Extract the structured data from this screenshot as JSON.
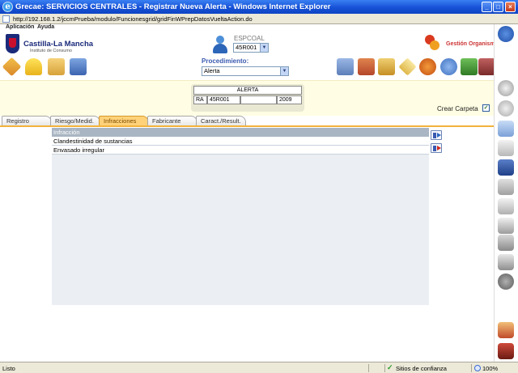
{
  "window": {
    "title": "Grecae: SERVICIOS CENTRALES - Registrar Nueva Alerta - Windows Internet Explorer",
    "url": "http://192.168.1.2/jccmPrueba/modulo/Funcionesgrid/gridFinWPrepDatosVueltaAction.do"
  },
  "menu": {
    "items": [
      "Aplicación",
      "Ayuda"
    ]
  },
  "header": {
    "logo_title": "Castilla-La Mancha",
    "logo_subtitle": "Instituto de Consumo",
    "user_name": "ESPCOAL",
    "user_code": "45R001",
    "procedimiento_label": "Procedimiento:",
    "procedimiento_value": "Alerta",
    "gestion_label": "Gestión Organismo"
  },
  "alerta": {
    "title": "ALERTA",
    "cells": [
      "RA",
      "45R001",
      "",
      "2009"
    ]
  },
  "crear_carpeta": {
    "label": "Crear Carpeta",
    "checked": true,
    "check_glyph": "✓"
  },
  "tabs": [
    {
      "label": "Registro",
      "active": false
    },
    {
      "label": "Riesgo/Medid.",
      "active": false
    },
    {
      "label": "Infracciones",
      "active": true
    },
    {
      "label": "Fabricante",
      "active": false
    },
    {
      "label": "Caract./Result.",
      "active": false
    }
  ],
  "grid": {
    "header": "Infracción",
    "rows": [
      "Clandestinidad de sustancias",
      "Envasado irregular"
    ]
  },
  "status": {
    "text": "Listo",
    "zone": "Sitios de confianza",
    "zoom": "100%",
    "zone_glyph": "✓"
  },
  "icons": {
    "window_buttons": [
      "_",
      "□",
      "×"
    ],
    "dropdown_arrow": "▼",
    "ie": "e"
  },
  "colors": {
    "titlebar": "#1651d6",
    "tab_active": "#ffd27a",
    "band": "#fffde3",
    "grid_header": "#a9b5c2"
  }
}
